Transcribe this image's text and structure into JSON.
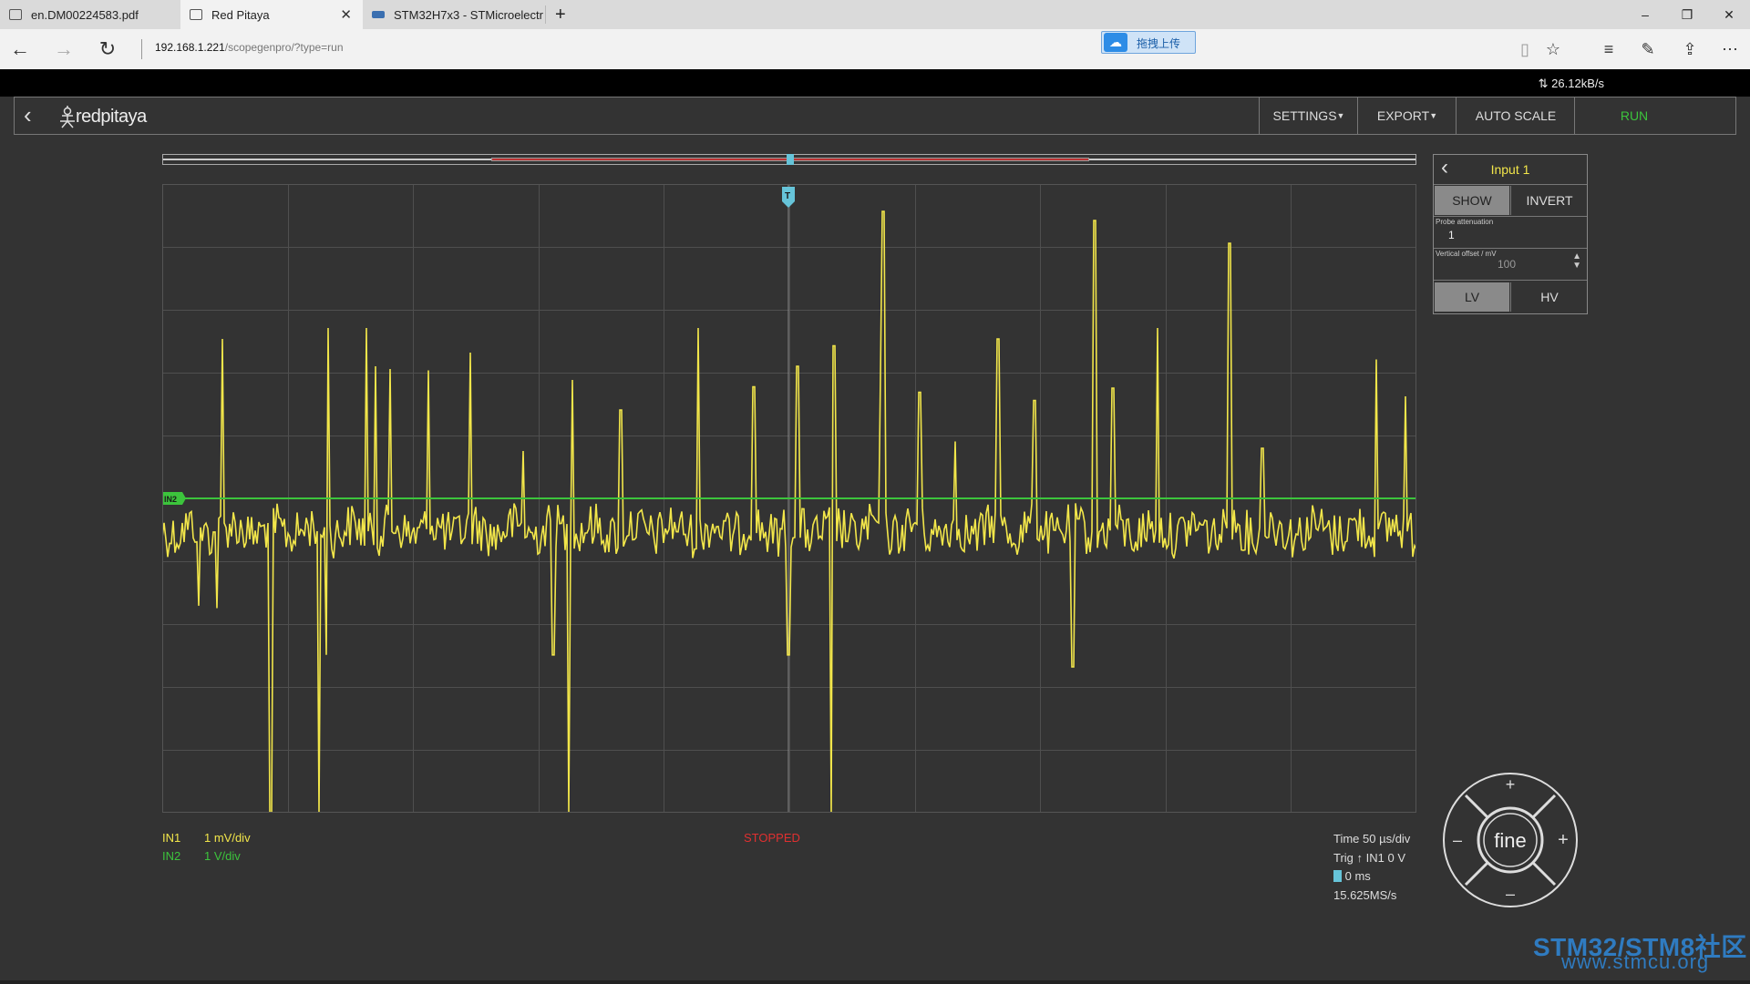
{
  "browser": {
    "tabs": [
      {
        "label": "en.DM00224583.pdf",
        "active": false
      },
      {
        "label": "Red Pitaya",
        "active": true
      },
      {
        "label": "STM32H7x3 - STMicroelectr",
        "active": false
      }
    ],
    "new_tab_symbol": "+",
    "url_host": "192.168.1.221",
    "url_path": "/scopegenpro/?type=run",
    "extension_label": "拖拽上传",
    "window_controls": [
      "–",
      "❐",
      "✕"
    ]
  },
  "app": {
    "transfer_rate": "26.12kB/s",
    "brand": "redpitaya",
    "menu": {
      "settings": "SETTINGS",
      "export": "EXPORT",
      "autoscale": "AUTO SCALE",
      "run": "RUN"
    },
    "trigger_marker": "T",
    "in2_marker": "IN2",
    "status": "STOPPED",
    "channels": [
      {
        "name": "IN1",
        "scale": "1 mV/div",
        "color": "#f2e64a"
      },
      {
        "name": "IN2",
        "scale": "1 V/div",
        "color": "#3cc43c"
      }
    ],
    "info": {
      "time": "Time 50 µs/div",
      "trig": "Trig",
      "trig_src": "IN1 0 V",
      "trig_time": "0 ms",
      "sample_rate": "15.625MS/s"
    }
  },
  "panel": {
    "title": "Input 1",
    "show": "SHOW",
    "invert": "INVERT",
    "probe_label": "Probe attenuation",
    "probe_value": "1",
    "offset_label": "Vertical offset / mV",
    "offset_value": "100",
    "lv": "LV",
    "hv": "HV"
  },
  "knob": {
    "center": "fine",
    "plus": "+",
    "minus": "–"
  },
  "watermark": {
    "line1": "STM32/STM8社区",
    "line2": "www.stmcu.org"
  },
  "colors": {
    "background": "#333333",
    "grid": "#4f4f4f",
    "in1": "#f2e64a",
    "in2": "#3cc43c",
    "accent": "#66c4d9",
    "run": "#3cc43c"
  }
}
